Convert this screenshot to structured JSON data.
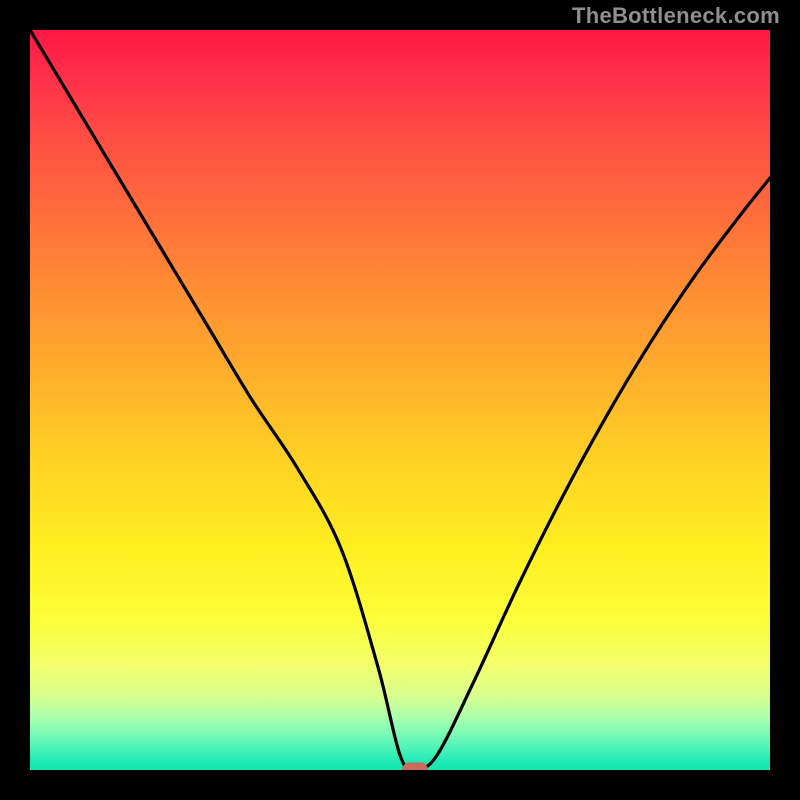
{
  "watermark": "TheBottleneck.com",
  "chart_data": {
    "type": "line",
    "title": "",
    "xlabel": "",
    "ylabel": "",
    "xlim": [
      0,
      100
    ],
    "ylim": [
      0,
      100
    ],
    "grid": false,
    "legend": false,
    "background_gradient": {
      "direction": "vertical",
      "top_color": "#ff1744",
      "mid_color": "#ffee20",
      "bottom_color": "#1de9b6",
      "meaning": "top=bad (red), bottom=good (green)"
    },
    "series": [
      {
        "name": "bottleneck-curve",
        "x": [
          0,
          6,
          12,
          18,
          24,
          30,
          36,
          42,
          47,
          50,
          52,
          55,
          60,
          66,
          72,
          78,
          84,
          90,
          96,
          100
        ],
        "y": [
          100,
          90,
          80,
          70,
          60,
          50,
          41,
          30,
          14,
          2,
          0,
          2,
          12,
          25,
          37,
          48,
          58,
          67,
          75,
          80
        ]
      }
    ],
    "marker": {
      "name": "optimal-point",
      "x": 52,
      "y": 0,
      "color": "#cc6a5c"
    }
  }
}
